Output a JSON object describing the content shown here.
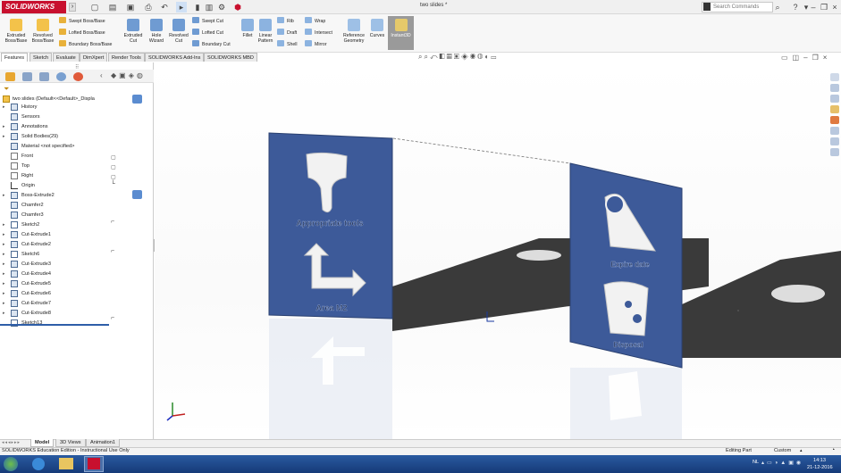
{
  "app": {
    "logo": "SOLIDWORKS",
    "doc_title": "two slides *"
  },
  "titlebar": {
    "search_placeholder": "Search Commands",
    "help": "?"
  },
  "ribbon": {
    "features": [
      {
        "label": "Extruded\nBoss/Base",
        "icon": "extrude-boss-icon"
      },
      {
        "label": "Revolved\nBoss/Base",
        "icon": "revolve-boss-icon"
      },
      {
        "label": "Swept Boss/Base",
        "icon": "swept-boss-icon"
      },
      {
        "label": "Lofted Boss/Base",
        "icon": "lofted-boss-icon"
      },
      {
        "label": "Boundary Boss/Base",
        "icon": "boundary-boss-icon"
      },
      {
        "label": "Extruded\nCut",
        "icon": "extruded-cut-icon"
      },
      {
        "label": "Hole\nWizard",
        "icon": "hole-wizard-icon"
      },
      {
        "label": "Revolved\nCut",
        "icon": "revolved-cut-icon"
      },
      {
        "label": "Swept Cut",
        "icon": "swept-cut-icon"
      },
      {
        "label": "Lofted Cut",
        "icon": "lofted-cut-icon"
      },
      {
        "label": "Boundary Cut",
        "icon": "boundary-cut-icon"
      },
      {
        "label": "Fillet",
        "icon": "fillet-icon"
      },
      {
        "label": "Linear\nPattern",
        "icon": "linear-pattern-icon"
      },
      {
        "label": "Rib",
        "icon": "rib-icon"
      },
      {
        "label": "Draft",
        "icon": "draft-icon"
      },
      {
        "label": "Shell",
        "icon": "shell-icon"
      },
      {
        "label": "Wrap",
        "icon": "wrap-icon"
      },
      {
        "label": "Intersect",
        "icon": "intersect-icon"
      },
      {
        "label": "Mirror",
        "icon": "mirror-icon"
      },
      {
        "label": "Reference\nGeometry",
        "icon": "reference-geometry-icon"
      },
      {
        "label": "Curves",
        "icon": "curves-icon"
      },
      {
        "label": "Instant3D",
        "icon": "instant3d-icon"
      }
    ]
  },
  "cm_tabs": [
    "Features",
    "Sketch",
    "Evaluate",
    "DimXpert",
    "Render Tools",
    "SOLIDWORKS Add-Ins",
    "SOLIDWORKS MBD"
  ],
  "tree": {
    "root": "two slides  (Default<<Default>_Displa",
    "items": [
      "History",
      "Sensors",
      "Annotations",
      "Solid Bodies(29)",
      "Material <not specified>",
      "Front",
      "Top",
      "Right",
      "Origin",
      "Boss-Extrude2",
      "Chamfer2",
      "Chamfer3",
      "Sketch2",
      "Cut-Extrude1",
      "Cut-Extrude2",
      "Sketch6",
      "Cut-Extrude3",
      "Cut-Extrude4",
      "Cut-Extrude5",
      "Cut-Extrude6",
      "Cut-Extrude7",
      "Cut-Extrude8",
      "Sketch13"
    ]
  },
  "viewport": {
    "left_panel": {
      "top_label": "Appropriate tools",
      "bottom_label": "Area M2"
    },
    "right_panel": {
      "top_label": "Expire date",
      "bottom_label": "Disposal"
    },
    "panel_color": "#3d5a99"
  },
  "bottom_tabs": [
    "Model",
    "3D Views",
    "Animation1"
  ],
  "status": {
    "left": "SOLIDWORKS Education Edition - Instructional Use Only",
    "mode": "Editing Part",
    "units": "Custom"
  },
  "taskbar": {
    "lang": "NL",
    "time": "14:13",
    "date": "21-12-2016"
  }
}
